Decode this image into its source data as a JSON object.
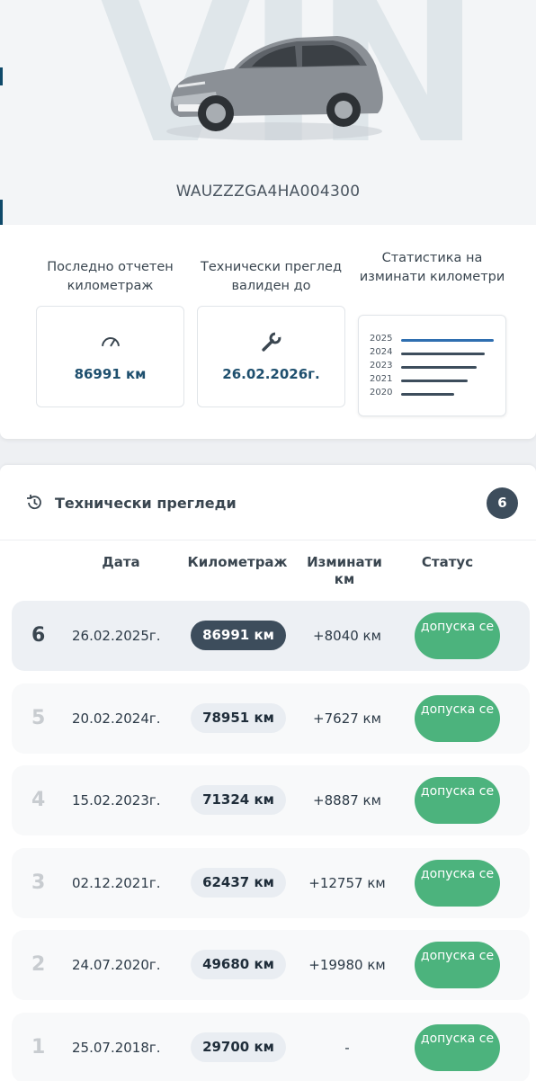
{
  "hero": {
    "watermark": "VIN",
    "vin": "WAUZZZGA4HA004300"
  },
  "stats": {
    "mileage_label": "Последно отчетен километраж",
    "mileage_value": "86991 км",
    "inspection_label": "Технически преглед валиден до",
    "inspection_value": "26.02.2026г.",
    "chart_label": "Статистика на изминати километри",
    "mini_chart": [
      {
        "year": "2025",
        "fraction": 1.0,
        "color": "#2f6fb0"
      },
      {
        "year": "2024",
        "fraction": 0.9,
        "color": "#3d4d5c"
      },
      {
        "year": "2023",
        "fraction": 0.82,
        "color": "#3d4d5c"
      },
      {
        "year": "2021",
        "fraction": 0.72,
        "color": "#3d4d5c"
      },
      {
        "year": "2020",
        "fraction": 0.57,
        "color": "#3d4d5c"
      }
    ]
  },
  "inspections": {
    "title": "Технически прегледи",
    "count": "6",
    "columns": {
      "date": "Дата",
      "km": "Километраж",
      "diff": "Изминати км",
      "status": "Статус"
    },
    "rows": [
      {
        "num": "6",
        "date": "26.02.2025г.",
        "km": "86991 км",
        "diff": "+8040 км",
        "status": "допуска се"
      },
      {
        "num": "5",
        "date": "20.02.2024г.",
        "km": "78951 км",
        "diff": "+7627 км",
        "status": "допуска се"
      },
      {
        "num": "4",
        "date": "15.02.2023г.",
        "km": "71324 км",
        "diff": "+8887 км",
        "status": "допуска се"
      },
      {
        "num": "3",
        "date": "02.12.2021г.",
        "km": "62437 км",
        "diff": "+12757 км",
        "status": "допуска се"
      },
      {
        "num": "2",
        "date": "24.07.2020г.",
        "km": "49680 км",
        "diff": "+19980 км",
        "status": "допуска се"
      },
      {
        "num": "1",
        "date": "25.07.2018г.",
        "km": "29700 км",
        "diff": "-",
        "status": "допуска се"
      }
    ]
  },
  "colors": {
    "accent": "#1e4f6e",
    "badge": "#3d4d5c",
    "status_ok": "#4cb37d"
  }
}
